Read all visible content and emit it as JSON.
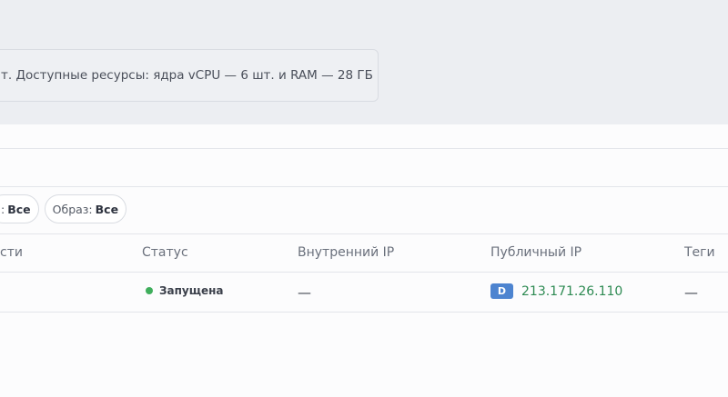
{
  "info": {
    "text": "т. Доступные ресурсы: ядра vCPU — 6 шт. и RAM — 28 ГБ"
  },
  "filters": [
    {
      "label": ":",
      "value": "Все"
    },
    {
      "label": "Образ:",
      "value": "Все"
    }
  ],
  "table": {
    "headers": {
      "name": "сти",
      "status": "Статус",
      "internal_ip": "Внутренний IP",
      "public_ip": "Публичный IP",
      "tags": "Теги"
    },
    "rows": [
      {
        "status": "Запущена",
        "status_color": "#3fae5c",
        "internal_ip": "—",
        "public_ip_badge": "D",
        "public_ip": "213.171.26.110",
        "tags": "—"
      }
    ]
  }
}
